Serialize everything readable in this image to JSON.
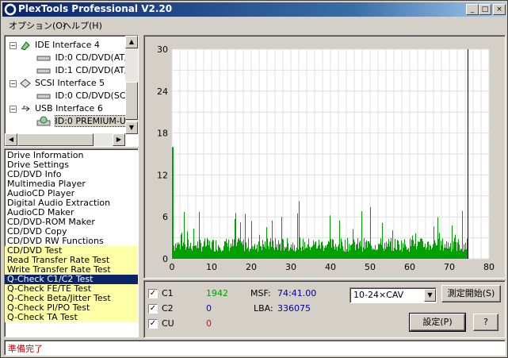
{
  "window": {
    "title": "PlexTools Professional V2.20",
    "controls": [
      "_",
      "□",
      "×"
    ]
  },
  "menu": [
    {
      "label": "オプション(O)"
    },
    {
      "label": "ヘルプ(H)"
    }
  ],
  "tree": [
    {
      "label": "IDE Interface 4",
      "icon": "ide-interface-icon",
      "level": 0,
      "expander": "−"
    },
    {
      "label": "ID:0  CD/DVD(AT/",
      "icon": "drive-icon",
      "level": 1
    },
    {
      "label": "ID:1  CD/DVD(AT/",
      "icon": "drive-icon",
      "level": 1
    },
    {
      "label": "SCSI Interface 5",
      "icon": "scsi-interface-icon",
      "level": 0,
      "expander": "−"
    },
    {
      "label": "ID:0  CD/DVD(SCS",
      "icon": "drive-icon",
      "level": 1
    },
    {
      "label": "USB Interface 6",
      "icon": "usb-interface-icon",
      "level": 0,
      "expander": "−"
    },
    {
      "label": "ID:0  PREMIUM-U",
      "icon": "disc-drive-icon",
      "level": 1,
      "selected": true
    }
  ],
  "functions": [
    {
      "label": "Drive Information"
    },
    {
      "label": "Drive Settings"
    },
    {
      "label": "CD/DVD Info"
    },
    {
      "label": "Multimedia Player"
    },
    {
      "label": "AudioCD Player"
    },
    {
      "label": "Digital Audio Extraction"
    },
    {
      "label": "AudioCD Maker"
    },
    {
      "label": "CD/DVD-ROM Maker"
    },
    {
      "label": "CD/DVD Copy"
    },
    {
      "label": "CD/DVD RW Functions"
    },
    {
      "label": "CD/DVD Test",
      "highlight": true
    },
    {
      "label": "Read Transfer Rate Test",
      "highlight": true
    },
    {
      "label": "Write Transfer Rate Test",
      "highlight": true
    },
    {
      "label": "Q-Check C1/C2 Test",
      "selected": true
    },
    {
      "label": "Q-Check FE/TE Test",
      "highlight": true
    },
    {
      "label": "Q-Check Beta/Jitter Test",
      "highlight": true
    },
    {
      "label": "Q-Check PI/PO Test",
      "highlight": true
    },
    {
      "label": "Q-Check TA Test",
      "highlight": true
    }
  ],
  "chart_data": {
    "type": "bar",
    "xlim": [
      0,
      80
    ],
    "ylim": [
      0,
      30
    ],
    "xticks": [
      "0",
      "10",
      "20",
      "30",
      "40",
      "50",
      "60",
      "70",
      "80"
    ],
    "yticks": [
      "0",
      "6",
      "12",
      "18",
      "24",
      "30"
    ],
    "grid": true,
    "end_marker_x": 74.69,
    "series": [
      {
        "color": "#00a000",
        "values_note": "",
        "x_end": 74.69
      }
    ]
  },
  "stats": {
    "c1": {
      "label": "C1",
      "value": "1942",
      "color": "#00a000",
      "checked": true
    },
    "c2": {
      "label": "C2",
      "value": "0",
      "color": "#0000ff",
      "checked": true
    },
    "cu": {
      "label": "CU",
      "value": "0",
      "color": "#ff0000",
      "checked": true
    },
    "msf_label": "MSF:",
    "msf_value": "74:41.00",
    "lba_label": "LBA:",
    "lba_value": "336075",
    "speed_select": "10-24×CAV",
    "start_button": "測定開始(S)",
    "settings_button": "設定(P)",
    "help_button": "?"
  },
  "status": "準備完了"
}
